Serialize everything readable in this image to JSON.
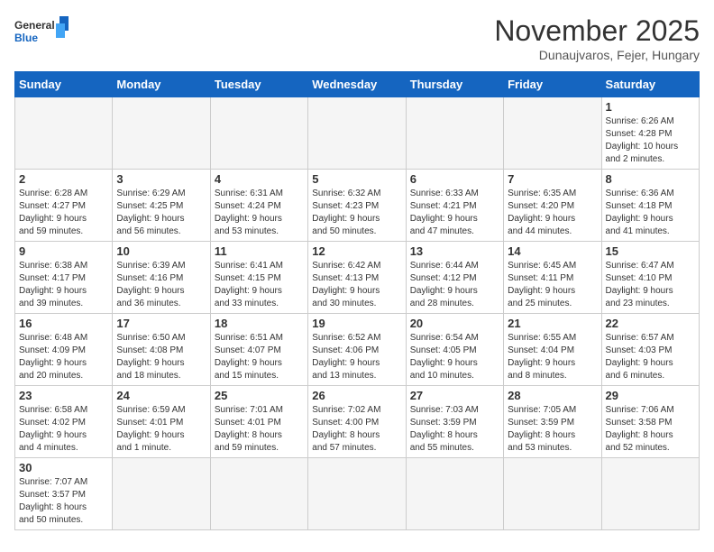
{
  "header": {
    "logo_line1": "General",
    "logo_line2": "Blue",
    "title": "November 2025",
    "subtitle": "Dunaujvaros, Fejer, Hungary"
  },
  "calendar": {
    "headers": [
      "Sunday",
      "Monday",
      "Tuesday",
      "Wednesday",
      "Thursday",
      "Friday",
      "Saturday"
    ],
    "weeks": [
      [
        {
          "day": "",
          "info": ""
        },
        {
          "day": "",
          "info": ""
        },
        {
          "day": "",
          "info": ""
        },
        {
          "day": "",
          "info": ""
        },
        {
          "day": "",
          "info": ""
        },
        {
          "day": "",
          "info": ""
        },
        {
          "day": "1",
          "info": "Sunrise: 6:26 AM\nSunset: 4:28 PM\nDaylight: 10 hours\nand 2 minutes."
        }
      ],
      [
        {
          "day": "2",
          "info": "Sunrise: 6:28 AM\nSunset: 4:27 PM\nDaylight: 9 hours\nand 59 minutes."
        },
        {
          "day": "3",
          "info": "Sunrise: 6:29 AM\nSunset: 4:25 PM\nDaylight: 9 hours\nand 56 minutes."
        },
        {
          "day": "4",
          "info": "Sunrise: 6:31 AM\nSunset: 4:24 PM\nDaylight: 9 hours\nand 53 minutes."
        },
        {
          "day": "5",
          "info": "Sunrise: 6:32 AM\nSunset: 4:23 PM\nDaylight: 9 hours\nand 50 minutes."
        },
        {
          "day": "6",
          "info": "Sunrise: 6:33 AM\nSunset: 4:21 PM\nDaylight: 9 hours\nand 47 minutes."
        },
        {
          "day": "7",
          "info": "Sunrise: 6:35 AM\nSunset: 4:20 PM\nDaylight: 9 hours\nand 44 minutes."
        },
        {
          "day": "8",
          "info": "Sunrise: 6:36 AM\nSunset: 4:18 PM\nDaylight: 9 hours\nand 41 minutes."
        }
      ],
      [
        {
          "day": "9",
          "info": "Sunrise: 6:38 AM\nSunset: 4:17 PM\nDaylight: 9 hours\nand 39 minutes."
        },
        {
          "day": "10",
          "info": "Sunrise: 6:39 AM\nSunset: 4:16 PM\nDaylight: 9 hours\nand 36 minutes."
        },
        {
          "day": "11",
          "info": "Sunrise: 6:41 AM\nSunset: 4:15 PM\nDaylight: 9 hours\nand 33 minutes."
        },
        {
          "day": "12",
          "info": "Sunrise: 6:42 AM\nSunset: 4:13 PM\nDaylight: 9 hours\nand 30 minutes."
        },
        {
          "day": "13",
          "info": "Sunrise: 6:44 AM\nSunset: 4:12 PM\nDaylight: 9 hours\nand 28 minutes."
        },
        {
          "day": "14",
          "info": "Sunrise: 6:45 AM\nSunset: 4:11 PM\nDaylight: 9 hours\nand 25 minutes."
        },
        {
          "day": "15",
          "info": "Sunrise: 6:47 AM\nSunset: 4:10 PM\nDaylight: 9 hours\nand 23 minutes."
        }
      ],
      [
        {
          "day": "16",
          "info": "Sunrise: 6:48 AM\nSunset: 4:09 PM\nDaylight: 9 hours\nand 20 minutes."
        },
        {
          "day": "17",
          "info": "Sunrise: 6:50 AM\nSunset: 4:08 PM\nDaylight: 9 hours\nand 18 minutes."
        },
        {
          "day": "18",
          "info": "Sunrise: 6:51 AM\nSunset: 4:07 PM\nDaylight: 9 hours\nand 15 minutes."
        },
        {
          "day": "19",
          "info": "Sunrise: 6:52 AM\nSunset: 4:06 PM\nDaylight: 9 hours\nand 13 minutes."
        },
        {
          "day": "20",
          "info": "Sunrise: 6:54 AM\nSunset: 4:05 PM\nDaylight: 9 hours\nand 10 minutes."
        },
        {
          "day": "21",
          "info": "Sunrise: 6:55 AM\nSunset: 4:04 PM\nDaylight: 9 hours\nand 8 minutes."
        },
        {
          "day": "22",
          "info": "Sunrise: 6:57 AM\nSunset: 4:03 PM\nDaylight: 9 hours\nand 6 minutes."
        }
      ],
      [
        {
          "day": "23",
          "info": "Sunrise: 6:58 AM\nSunset: 4:02 PM\nDaylight: 9 hours\nand 4 minutes."
        },
        {
          "day": "24",
          "info": "Sunrise: 6:59 AM\nSunset: 4:01 PM\nDaylight: 9 hours\nand 1 minute."
        },
        {
          "day": "25",
          "info": "Sunrise: 7:01 AM\nSunset: 4:01 PM\nDaylight: 8 hours\nand 59 minutes."
        },
        {
          "day": "26",
          "info": "Sunrise: 7:02 AM\nSunset: 4:00 PM\nDaylight: 8 hours\nand 57 minutes."
        },
        {
          "day": "27",
          "info": "Sunrise: 7:03 AM\nSunset: 3:59 PM\nDaylight: 8 hours\nand 55 minutes."
        },
        {
          "day": "28",
          "info": "Sunrise: 7:05 AM\nSunset: 3:59 PM\nDaylight: 8 hours\nand 53 minutes."
        },
        {
          "day": "29",
          "info": "Sunrise: 7:06 AM\nSunset: 3:58 PM\nDaylight: 8 hours\nand 52 minutes."
        }
      ],
      [
        {
          "day": "30",
          "info": "Sunrise: 7:07 AM\nSunset: 3:57 PM\nDaylight: 8 hours\nand 50 minutes."
        },
        {
          "day": "",
          "info": ""
        },
        {
          "day": "",
          "info": ""
        },
        {
          "day": "",
          "info": ""
        },
        {
          "day": "",
          "info": ""
        },
        {
          "day": "",
          "info": ""
        },
        {
          "day": "",
          "info": ""
        }
      ]
    ]
  }
}
